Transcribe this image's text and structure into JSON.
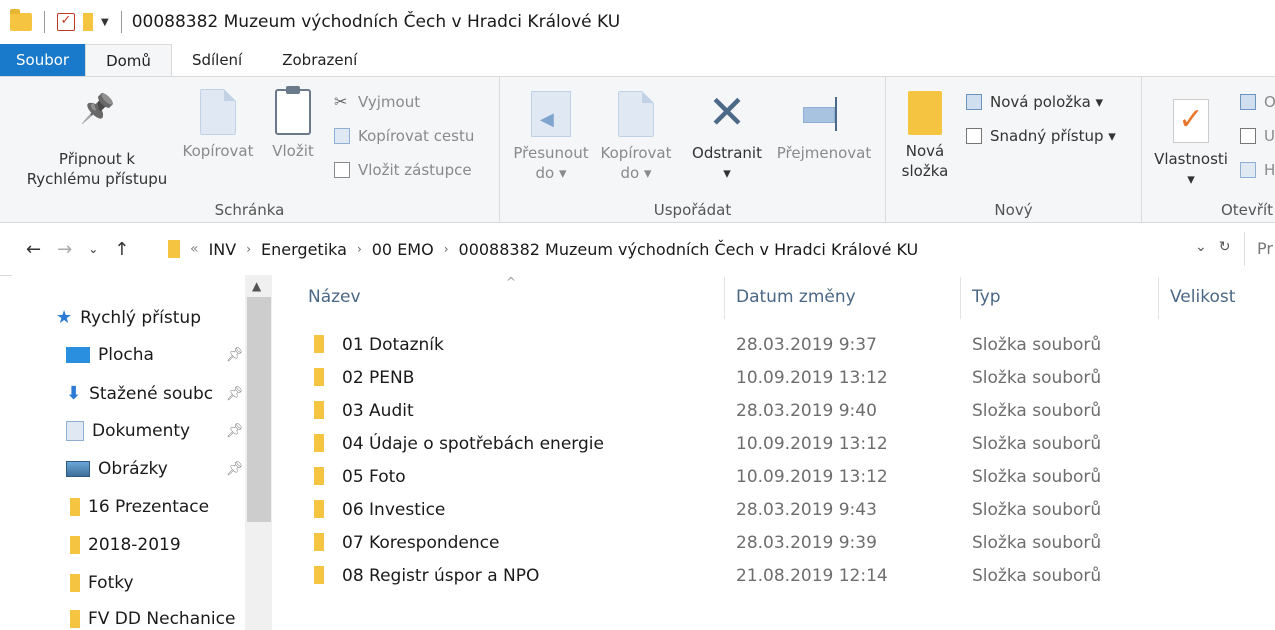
{
  "window": {
    "title": "00088382 Muzeum východních Čech v Hradci Králové KU"
  },
  "tabs": [
    {
      "label": "Soubor"
    },
    {
      "label": "Domů"
    },
    {
      "label": "Sdílení"
    },
    {
      "label": "Zobrazení"
    }
  ],
  "ribbon": {
    "clipboard": {
      "pin_line1": "Připnout k",
      "pin_line2": "Rychlému přístupu",
      "copy": "Kopírovat",
      "paste": "Vložit",
      "cut": "Vyjmout",
      "copy_path": "Kopírovat cestu",
      "paste_shortcut": "Vložit zástupce",
      "label": "Schránka"
    },
    "organize": {
      "move_line1": "Přesunout",
      "move_line2": "do ▾",
      "copyto_line1": "Kopírovat",
      "copyto_line2": "do ▾",
      "delete_line1": "Odstranit",
      "delete_line2": "▾",
      "rename": "Přejmenovat",
      "label": "Uspořádat"
    },
    "new": {
      "folder_line1": "Nová",
      "folder_line2": "složka",
      "new_item": "Nová položka ▾",
      "easy_access": "Snadný přístup ▾",
      "label": "Nový"
    },
    "open": {
      "properties": "Vlastnosti",
      "properties_arrow": "▾",
      "partial1": "O",
      "partial2": "U",
      "partial3": "H",
      "label": "Otevřít"
    }
  },
  "address": {
    "overflow": "«",
    "crumbs": [
      "INV",
      "Energetika",
      "00 EMO",
      "00088382 Muzeum východních Čech v Hradci Králové KU"
    ],
    "search_placeholder": "Pr"
  },
  "sidebar": {
    "items": [
      {
        "label": "Rychlý přístup",
        "icon": "star-icon"
      },
      {
        "label": "Plocha",
        "icon": "desktop-icon",
        "pinned": true
      },
      {
        "label": "Stažené soubc",
        "icon": "download-icon",
        "pinned": true
      },
      {
        "label": "Dokumenty",
        "icon": "documents-icon",
        "pinned": true
      },
      {
        "label": "Obrázky",
        "icon": "pictures-icon",
        "pinned": true
      },
      {
        "label": "16 Prezentace",
        "icon": "folder-icon"
      },
      {
        "label": "2018-2019",
        "icon": "folder-icon"
      },
      {
        "label": "Fotky",
        "icon": "folder-icon"
      },
      {
        "label": "FV DD Nechanice",
        "icon": "folder-icon"
      }
    ]
  },
  "columns": {
    "name": "Název",
    "date": "Datum změny",
    "type": "Typ",
    "size": "Velikost"
  },
  "files": [
    {
      "name": "01 Dotazník",
      "date": "28.03.2019 9:37",
      "type": "Složka souborů"
    },
    {
      "name": "02 PENB",
      "date": "10.09.2019 13:12",
      "type": "Složka souborů"
    },
    {
      "name": "03 Audit",
      "date": "28.03.2019 9:40",
      "type": "Složka souborů"
    },
    {
      "name": "04 Údaje o spotřebách energie",
      "date": "10.09.2019 13:12",
      "type": "Složka souborů"
    },
    {
      "name": "05 Foto",
      "date": "10.09.2019 13:12",
      "type": "Složka souborů"
    },
    {
      "name": "06 Investice",
      "date": "28.03.2019 9:43",
      "type": "Složka souborů"
    },
    {
      "name": "07 Korespondence",
      "date": "28.03.2019 9:39",
      "type": "Složka souborů"
    },
    {
      "name": "08 Registr úspor a NPO",
      "date": "21.08.2019 12:14",
      "type": "Složka souborů"
    }
  ]
}
